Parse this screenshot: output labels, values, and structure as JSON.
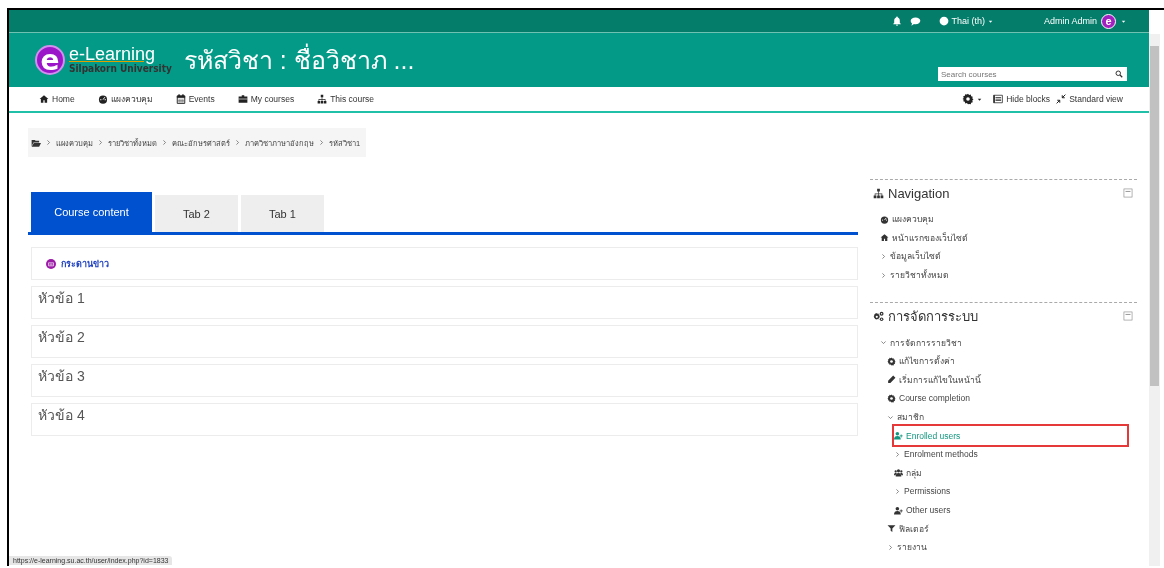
{
  "top_bar": {
    "language": "Thai (th)",
    "user": {
      "name": "Admin Admin",
      "avatar_letter": "e"
    }
  },
  "header": {
    "logo": {
      "letter": "e",
      "name": "e-Learning",
      "subtitle": "Silpakorn University"
    },
    "title": "รหัสวิชา : ชื่อวิชาภ ...",
    "search": {
      "placeholder": "Search courses"
    }
  },
  "nav_bar": {
    "items": [
      {
        "label": "Home",
        "kind": "home"
      },
      {
        "label": "แผงควบคุม",
        "kind": "dashboard"
      },
      {
        "label": "Events",
        "kind": "calendar"
      },
      {
        "label": "My courses",
        "kind": "briefcase"
      },
      {
        "label": "This course",
        "kind": "sitemap"
      }
    ],
    "right": [
      {
        "label": "Hide blocks",
        "kind": "blocks"
      },
      {
        "label": "Standard view",
        "kind": "compress"
      }
    ]
  },
  "breadcrumb": [
    "แผงควบคุม",
    "รายวิชาทั้งหมด",
    "คณะอักษรศาสตร์",
    "ภาควิชาภาษาอังกฤษ",
    "รหัสวิชา1"
  ],
  "tabs": [
    {
      "label": "Course content",
      "selected": true
    },
    {
      "label": "Tab 2",
      "selected": false
    },
    {
      "label": "Tab 1",
      "selected": false
    }
  ],
  "news_forum": "กระดานข่าว",
  "sections": [
    "หัวข้อ 1",
    "หัวข้อ 2",
    "หัวข้อ 3",
    "หัวข้อ 4"
  ],
  "blocks": [
    {
      "title": "Navigation",
      "kind": "sitemap",
      "items": [
        {
          "label": "แผงควบคุม",
          "kind": "dashboard",
          "highlighted": false
        },
        {
          "label": "หน้าแรกของเว็บไซต์",
          "kind": "home",
          "highlighted": false
        },
        {
          "label": "ข้อมูลเว็บไซต์",
          "kind": "branch",
          "expanded": false,
          "highlighted": false
        },
        {
          "label": "รายวิชาทั้งหมด",
          "kind": "branch",
          "expanded": false,
          "highlighted": false
        }
      ]
    },
    {
      "title": "การจัดการระบบ",
      "kind": "cogs",
      "items": [
        {
          "label": "การจัดการรายวิชา",
          "kind": "branch",
          "expanded": true,
          "highlighted": false,
          "children": [
            {
              "label": "แก้ไขการตั้งค่า",
              "kind": "gear",
              "highlighted": false
            },
            {
              "label": "เริ่มการแก้ไขในหน้านี้",
              "kind": "pencil",
              "highlighted": false
            },
            {
              "label": "Course completion",
              "kind": "gear",
              "highlighted": false
            },
            {
              "label": "สมาชิก",
              "kind": "branch",
              "expanded": true,
              "highlighted": false,
              "children": [
                {
                  "label": "Enrolled users",
                  "kind": "user-plus",
                  "highlighted": true
                },
                {
                  "label": "Enrolment methods",
                  "kind": "branch",
                  "expanded": false,
                  "highlighted": false
                },
                {
                  "label": "กลุ่ม",
                  "kind": "users",
                  "highlighted": false
                },
                {
                  "label": "Permissions",
                  "kind": "branch",
                  "expanded": false,
                  "highlighted": false
                },
                {
                  "label": "Other users",
                  "kind": "user-plus",
                  "highlighted": false
                }
              ]
            },
            {
              "label": "ฟิลเตอร์",
              "kind": "filter",
              "highlighted": false
            },
            {
              "label": "รายงาน",
              "kind": "branch",
              "expanded": false,
              "highlighted": false
            }
          ]
        }
      ]
    }
  ],
  "status_url": "https://e-learning.su.ac.th/user/index.php?id=1833"
}
